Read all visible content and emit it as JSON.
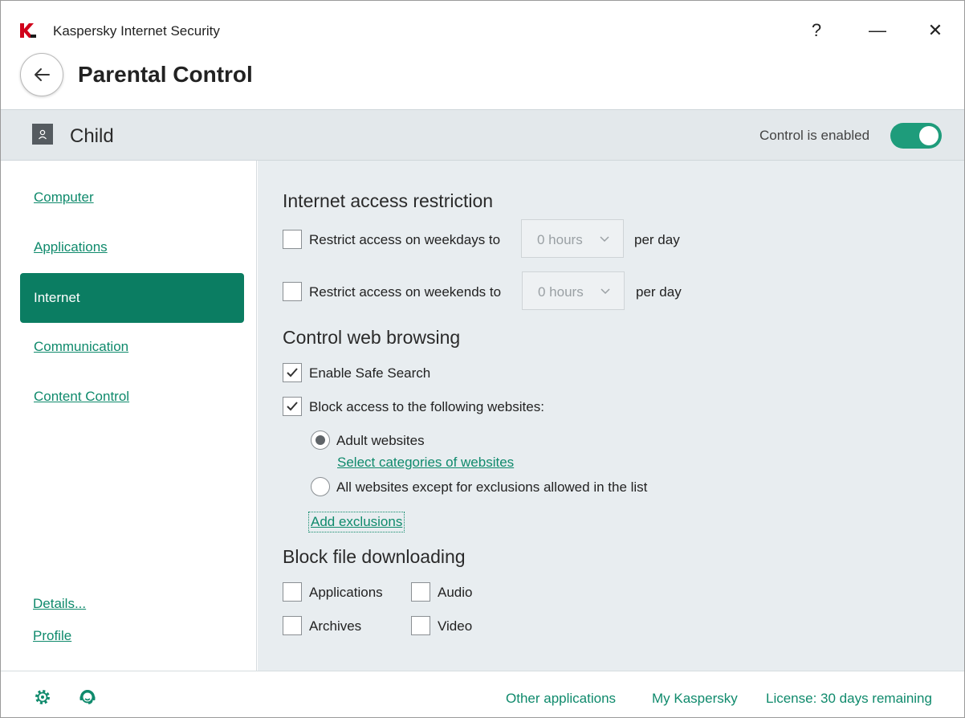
{
  "window": {
    "app_title": "Kaspersky Internet Security",
    "help_glyph": "?",
    "minimize_glyph": "—",
    "close_glyph": "✕"
  },
  "header": {
    "page_title": "Parental Control"
  },
  "profile": {
    "name": "Child",
    "control_label": "Control is enabled",
    "control_enabled": true
  },
  "sidebar": {
    "items": [
      {
        "label": "Computer"
      },
      {
        "label": "Applications"
      },
      {
        "label": "Internet"
      },
      {
        "label": "Communication"
      },
      {
        "label": "Content Control"
      }
    ],
    "details_label": "Details...",
    "profile_label": "Profile"
  },
  "internet_access": {
    "title": "Internet access restriction",
    "weekdays_label": "Restrict access on weekdays to",
    "weekdays_value": "0 hours",
    "weekdays_suffix": "per day",
    "weekends_label": "Restrict access on weekends to",
    "weekends_value": "0 hours",
    "weekends_suffix": "per day"
  },
  "web_browsing": {
    "title": "Control web browsing",
    "safe_search_label": "Enable Safe Search",
    "block_label": "Block access to the following websites:",
    "adult_label": "Adult websites",
    "select_categories_link": "Select categories of websites",
    "all_except_label": "All websites except for exclusions allowed in the list",
    "add_exclusions_link": "Add exclusions"
  },
  "file_downloading": {
    "title": "Block file downloading",
    "applications_label": "Applications",
    "audio_label": "Audio",
    "archives_label": "Archives",
    "video_label": "Video"
  },
  "footer": {
    "other_apps": "Other applications",
    "my_kaspersky": "My Kaspersky",
    "license": "License: 30 days remaining"
  },
  "colors": {
    "accent": "#0b7d62",
    "link": "#0f8a6c",
    "toggle": "#1e9c7b",
    "brand_red": "#d0021b"
  }
}
